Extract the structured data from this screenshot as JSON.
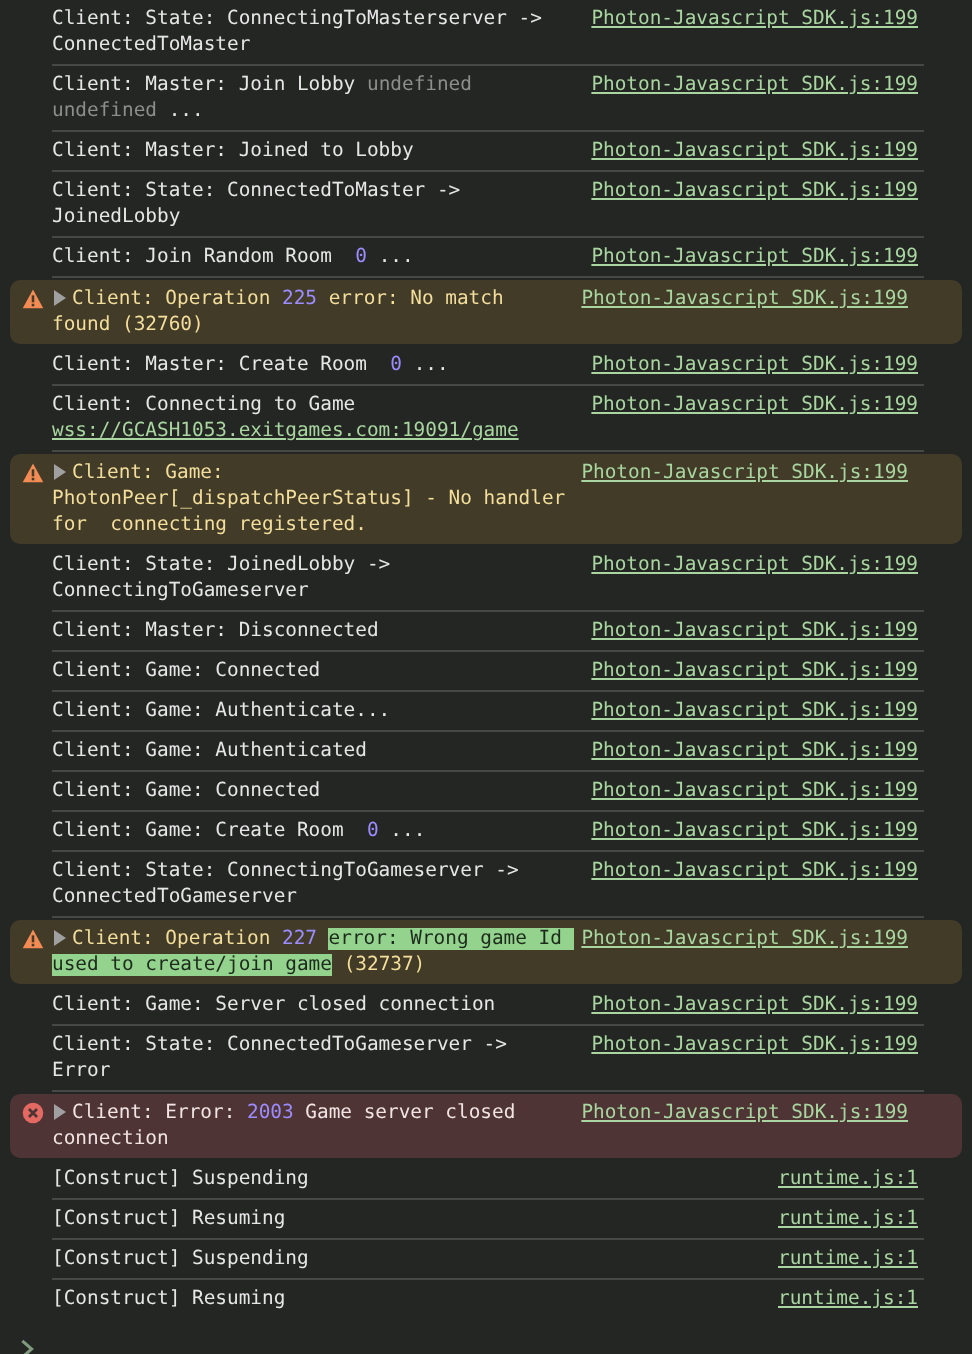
{
  "console": {
    "rows": [
      {
        "kind": "log",
        "source": "Photon-Javascript SDK.js:199",
        "message": [
          {
            "kind": "text",
            "text": "Client: State: ConnectingToMasterserver -> ConnectedToMaster"
          }
        ]
      },
      {
        "kind": "log",
        "source": "Photon-Javascript SDK.js:199",
        "message": [
          {
            "kind": "text",
            "text": "Client: Master: Join Lobby "
          },
          {
            "kind": "dim",
            "text": "undefined undefined"
          },
          {
            "kind": "text",
            "text": " ..."
          }
        ]
      },
      {
        "kind": "log",
        "source": "Photon-Javascript SDK.js:199",
        "message": [
          {
            "kind": "text",
            "text": "Client: Master: Joined to Lobby"
          }
        ]
      },
      {
        "kind": "log",
        "source": "Photon-Javascript SDK.js:199",
        "message": [
          {
            "kind": "text",
            "text": "Client: State: ConnectedToMaster -> JoinedLobby"
          }
        ]
      },
      {
        "kind": "log",
        "source": "Photon-Javascript SDK.js:199",
        "message": [
          {
            "kind": "text",
            "text": "Client: Join Random Room  "
          },
          {
            "kind": "number",
            "text": "0"
          },
          {
            "kind": "text",
            "text": " ..."
          }
        ]
      },
      {
        "kind": "warning",
        "source": "Photon-Javascript SDK.js:199",
        "message": [
          {
            "kind": "text",
            "text": "Client: Operation "
          },
          {
            "kind": "number",
            "text": "225"
          },
          {
            "kind": "text",
            "text": " error: No match found (32760)"
          }
        ]
      },
      {
        "kind": "log",
        "source": "Photon-Javascript SDK.js:199",
        "message": [
          {
            "kind": "text",
            "text": "Client: Master: Create Room  "
          },
          {
            "kind": "number",
            "text": "0"
          },
          {
            "kind": "text",
            "text": " ..."
          }
        ]
      },
      {
        "kind": "log",
        "source": "Photon-Javascript SDK.js:199",
        "message": [
          {
            "kind": "text",
            "text": "Client: Connecting to Game "
          },
          {
            "kind": "link",
            "text": "wss://GCASH1053.exitgames.com:19091/game"
          }
        ]
      },
      {
        "kind": "warning",
        "source": "Photon-Javascript SDK.js:199",
        "message": [
          {
            "kind": "text",
            "text": "Client: Game: PhotonPeer[_dispatchPeerStatus] - No handler for  connecting registered."
          }
        ]
      },
      {
        "kind": "log",
        "source": "Photon-Javascript SDK.js:199",
        "message": [
          {
            "kind": "text",
            "text": "Client: State: JoinedLobby -> ConnectingToGameserver"
          }
        ]
      },
      {
        "kind": "log",
        "source": "Photon-Javascript SDK.js:199",
        "message": [
          {
            "kind": "text",
            "text": "Client: Master: Disconnected"
          }
        ]
      },
      {
        "kind": "log",
        "source": "Photon-Javascript SDK.js:199",
        "message": [
          {
            "kind": "text",
            "text": "Client: Game: Connected"
          }
        ]
      },
      {
        "kind": "log",
        "source": "Photon-Javascript SDK.js:199",
        "message": [
          {
            "kind": "text",
            "text": "Client: Game: Authenticate..."
          }
        ]
      },
      {
        "kind": "log",
        "source": "Photon-Javascript SDK.js:199",
        "message": [
          {
            "kind": "text",
            "text": "Client: Game: Authenticated"
          }
        ]
      },
      {
        "kind": "log",
        "source": "Photon-Javascript SDK.js:199",
        "message": [
          {
            "kind": "text",
            "text": "Client: Game: Connected"
          }
        ]
      },
      {
        "kind": "log",
        "source": "Photon-Javascript SDK.js:199",
        "message": [
          {
            "kind": "text",
            "text": "Client: Game: Create Room  "
          },
          {
            "kind": "number",
            "text": "0"
          },
          {
            "kind": "text",
            "text": " ..."
          }
        ]
      },
      {
        "kind": "log",
        "source": "Photon-Javascript SDK.js:199",
        "message": [
          {
            "kind": "text",
            "text": "Client: State: ConnectingToGameserver -> ConnectedToGameserver"
          }
        ]
      },
      {
        "kind": "warning",
        "source": "Photon-Javascript SDK.js:199",
        "message": [
          {
            "kind": "text",
            "text": "Client: Operation "
          },
          {
            "kind": "number",
            "text": "227"
          },
          {
            "kind": "highlight",
            "text": "error: Wrong game Id used to create/join game"
          },
          {
            "kind": "text",
            "text": " (32737)"
          }
        ]
      },
      {
        "kind": "log",
        "source": "Photon-Javascript SDK.js:199",
        "message": [
          {
            "kind": "text",
            "text": "Client: Game: Server closed connection"
          }
        ]
      },
      {
        "kind": "log",
        "source": "Photon-Javascript SDK.js:199",
        "message": [
          {
            "kind": "text",
            "text": "Client: State: ConnectedToGameserver -> Error"
          }
        ]
      },
      {
        "kind": "error",
        "source": "Photon-Javascript SDK.js:199",
        "message": [
          {
            "kind": "text",
            "text": "Client: Error: "
          },
          {
            "kind": "number",
            "text": "2003"
          },
          {
            "kind": "text",
            "text": " Game server closed connection"
          }
        ]
      },
      {
        "kind": "log",
        "source": "runtime.js:1",
        "message": [
          {
            "kind": "text",
            "text": "[Construct] Suspending"
          }
        ]
      },
      {
        "kind": "log",
        "source": "runtime.js:1",
        "message": [
          {
            "kind": "text",
            "text": "[Construct] Resuming"
          }
        ]
      },
      {
        "kind": "log",
        "source": "runtime.js:1",
        "message": [
          {
            "kind": "text",
            "text": "[Construct] Suspending"
          }
        ]
      },
      {
        "kind": "log",
        "source": "runtime.js:1",
        "message": [
          {
            "kind": "text",
            "text": "[Construct] Resuming"
          }
        ]
      }
    ]
  }
}
